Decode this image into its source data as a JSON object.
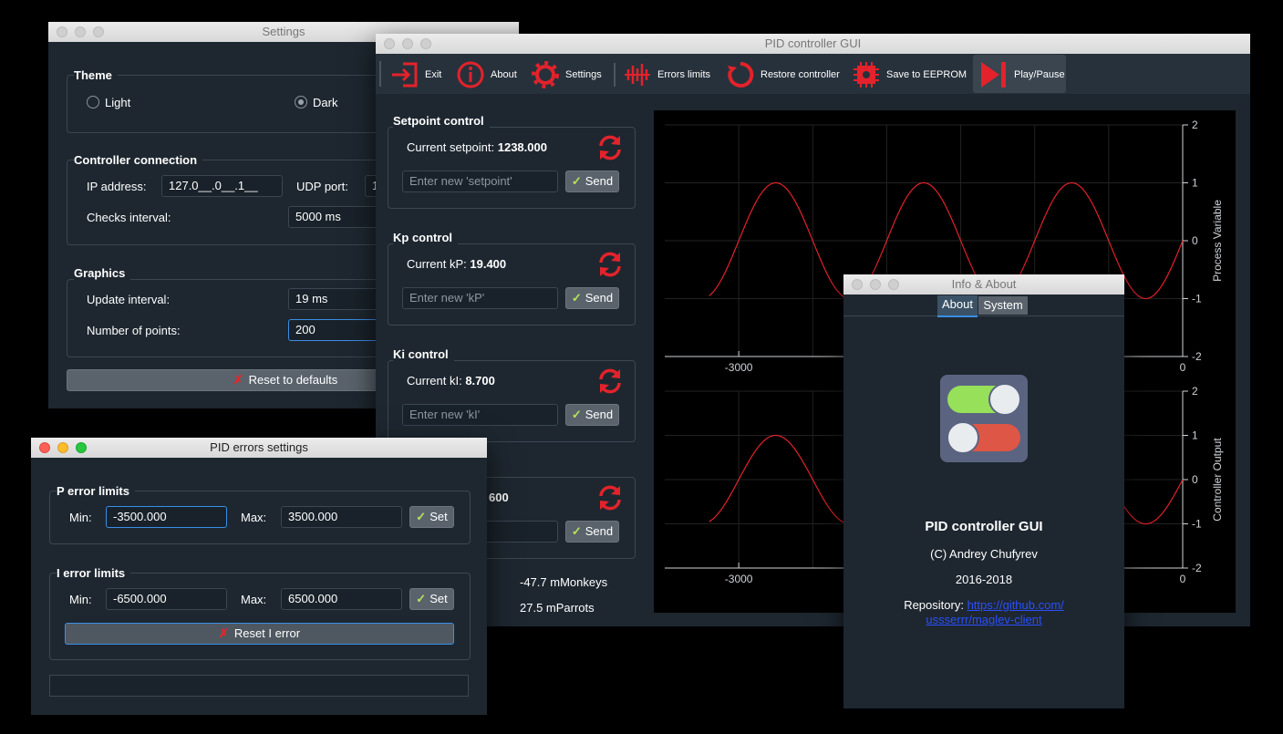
{
  "settings": {
    "title": "Settings",
    "theme": {
      "label": "Theme",
      "light": "Light",
      "dark": "Dark",
      "selected": "Dark"
    },
    "connection": {
      "label": "Controller connection",
      "ip_label": "IP address:",
      "ip_value": "127.0__.0__.1__",
      "udp_label": "UDP port:",
      "udp_value": "1",
      "checks_label": "Checks interval:",
      "checks_value": "5000 ms"
    },
    "graphics": {
      "label": "Graphics",
      "update_label": "Update interval:",
      "update_value": "19 ms",
      "points_label": "Number of points:",
      "points_value": "200"
    },
    "reset_label": "Reset to defaults"
  },
  "main": {
    "title": "PID controller GUI",
    "toolbar": [
      "Exit",
      "About",
      "Settings",
      "Errors limits",
      "Restore controller",
      "Save to EEPROM",
      "Play/Pause"
    ],
    "setpoint": {
      "title": "Setpoint control",
      "current_label": "Current setpoint:",
      "current_value": "1238.000",
      "placeholder": "Enter new 'setpoint'",
      "send": "Send"
    },
    "kp": {
      "title": "Kp control",
      "current_label": "Current kP:",
      "current_value": "19.400",
      "placeholder": "Enter new 'kP'",
      "send": "Send"
    },
    "ki": {
      "title": "Ki control",
      "current_label": "Current kI:",
      "current_value": "8.700",
      "placeholder": "Enter new 'kI'",
      "send": "Send"
    },
    "kd": {
      "current_value_partial": "600",
      "send": "Send"
    },
    "status": {
      "monkeys": "-47.7 mMonkeys",
      "parrots": "27.5 mParrots"
    },
    "colors": {
      "toolbar_accent": "#e3222b",
      "plot_line": "#e3222b"
    }
  },
  "chart_data": [
    {
      "type": "line",
      "title": "",
      "xlabel": "",
      "ylabel": "Process Variable",
      "xlim": [
        -3500,
        0
      ],
      "ylim": [
        -2,
        2
      ],
      "x_ticks": [
        "-3000",
        "0"
      ],
      "y_ticks": [
        "2",
        "1",
        "0",
        "-1",
        "-2"
      ],
      "grid": true,
      "series": [
        {
          "function": "sine",
          "amplitude": 1,
          "period": 1000,
          "phase_at_x0": 0,
          "points": 200
        }
      ]
    },
    {
      "type": "line",
      "title": "",
      "xlabel": "",
      "ylabel": "Controller Output",
      "xlim": [
        -3500,
        0
      ],
      "ylim": [
        -2,
        2
      ],
      "x_ticks": [
        "-3000",
        "0"
      ],
      "y_ticks": [
        "2",
        "1",
        "0",
        "-1",
        "-2"
      ],
      "grid": true,
      "series": [
        {
          "function": "sine",
          "amplitude": 1,
          "period": 1000,
          "phase_at_x0": 0,
          "points": 200
        }
      ]
    }
  ],
  "errors": {
    "title": "PID errors settings",
    "p": {
      "title": "P error limits",
      "min_label": "Min:",
      "min_value": "-3500.000",
      "max_label": "Max:",
      "max_value": "3500.000",
      "set": "Set"
    },
    "i": {
      "title": "I error limits",
      "min_label": "Min:",
      "min_value": "-6500.000",
      "max_label": "Max:",
      "max_value": "6500.000",
      "set": "Set",
      "reset": "Reset I error"
    }
  },
  "about": {
    "title": "Info & About",
    "tabs": [
      "About",
      "System"
    ],
    "app_name": "PID controller GUI",
    "author": "(C) Andrey Chufyrev",
    "years": "2016-2018",
    "repo_label": "Repository:",
    "repo_link_line1": "https://github.com/",
    "repo_link_line2": "ussserrr/maglev-client"
  }
}
